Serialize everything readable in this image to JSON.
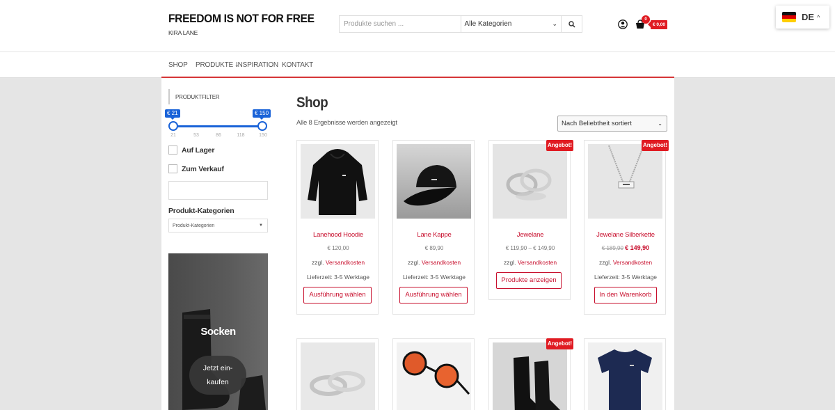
{
  "header": {
    "title": "FREEDOM IS NOT FOR FREE",
    "subtitle": "KIRA LANE",
    "search_placeholder": "Produkte suchen ...",
    "search_category": "Alle Kategorien",
    "cart_count": "0",
    "cart_total": "€ 0,00",
    "language": "DE",
    "icons": {
      "search": "search-icon",
      "user": "user-icon",
      "cart": "cart-icon",
      "flag": "germany-flag-icon"
    }
  },
  "nav": {
    "items": [
      {
        "label": "SHOP"
      },
      {
        "label": "PRODUKTE"
      },
      {
        "label": "INSPIRATION"
      },
      {
        "label": "KONTAKT"
      }
    ],
    "active": "SHOP",
    "accent_color": "#d63638"
  },
  "sidebar": {
    "filter_title": "PRODUKTFILTER",
    "price_min_label": "€ 21",
    "price_max_label": "€ 150",
    "price_min": 21,
    "price_max": 150,
    "ticks": [
      "21",
      "53",
      "86",
      "118",
      "150"
    ],
    "filters": [
      {
        "label": "Auf Lager",
        "checked": false
      },
      {
        "label": "Zum Verkauf",
        "checked": false
      }
    ],
    "category_heading": "Produkt-Kategorien",
    "category_select": "Produkt-Kategorien",
    "promo": {
      "title": "Socken",
      "button": "Jetzt ein-\nkaufen"
    }
  },
  "shop": {
    "title": "Shop",
    "result_count": "Alle 8 Ergebnisse werden angezeigt",
    "sort": "Nach Beliebtheit sortiert",
    "ship_prefix": "zzgl.",
    "ship_link": "Versandkosten",
    "products": [
      {
        "name": "Lanehood Hoodie",
        "price": "€ 120,00",
        "delivery": "Lieferzeit: 3-5 Werktage",
        "button": "Ausführung wählen",
        "badge": ""
      },
      {
        "name": "Lane Kappe",
        "price": "€ 89,90",
        "delivery": "Lieferzeit: 3-5 Werktage",
        "button": "Ausführung wählen",
        "badge": ""
      },
      {
        "name": "Jewelane",
        "price": "€ 119,90 – € 149,90",
        "delivery": "",
        "button": "Produkte anzeigen",
        "badge": "Angebot!"
      },
      {
        "name": "Jewelane Silberkette",
        "price_old": "€ 189,90",
        "price": "€ 149,90",
        "delivery": "Lieferzeit: 3-5 Werktage",
        "button": "In den Warenkorb",
        "badge": "Angebot!"
      },
      {
        "name": "",
        "badge": ""
      },
      {
        "name": "",
        "badge": ""
      },
      {
        "name": "",
        "badge": "Angebot!"
      },
      {
        "name": "",
        "badge": ""
      }
    ]
  }
}
